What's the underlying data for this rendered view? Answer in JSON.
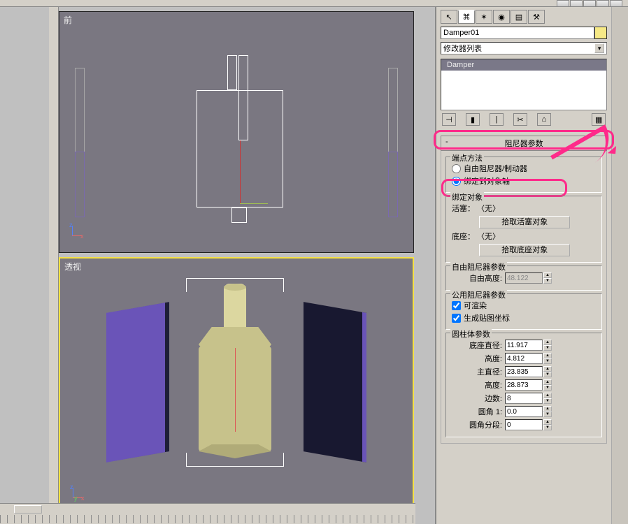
{
  "viewports": {
    "front_label": "前",
    "persp_label": "透视"
  },
  "axes": {
    "z": "z",
    "y": "y",
    "x": "x"
  },
  "panel": {
    "object_name": "Damper01",
    "modifier_dropdown": "修改器列表",
    "stack_item": "Damper",
    "rollout_damper_params": "阻尼器参数",
    "rollout_minus": "-",
    "end_method_title": "端点方法",
    "radio_free": "自由阻尼器/制动器",
    "radio_bound": "绑定到对象轴",
    "bind_group": "绑定对象",
    "piston_label": "活塞：",
    "none_value": "〈无〉",
    "pick_piston": "拾取活塞对象",
    "base_label": "底座：",
    "pick_base": "拾取底座对象",
    "free_params_title": "自由阻尼器参数",
    "free_height_label": "自由高度:",
    "free_height_value": "48.122",
    "common_params_title": "公用阻尼器参数",
    "renderable": "可渲染",
    "gen_mapping": "生成贴图坐标",
    "cyl_params_title": "圆柱体参数",
    "base_diameter_label": "底座直径:",
    "base_diameter_value": "11.917",
    "height_label": "高度:",
    "height_value": "4.812",
    "main_diameter_label": "主直径:",
    "main_diameter_value": "23.835",
    "main_height_label": "高度:",
    "main_height_value": "28.873",
    "sides_label": "边数:",
    "sides_value": "8",
    "fillet1_label": "圆角 1:",
    "fillet1_value": "0.0",
    "fillet_seg_label": "圆角分段:",
    "fillet_seg_value": "0"
  },
  "icons": {
    "arrow": "↖",
    "link": "⌘",
    "compass": "✶",
    "globe": "◉",
    "doc": "▤",
    "hammer": "⚒",
    "pin": "⊣",
    "stack1": "▮",
    "stack2": "|",
    "scissors": "✂",
    "lock": "⌂",
    "config": "▦"
  }
}
